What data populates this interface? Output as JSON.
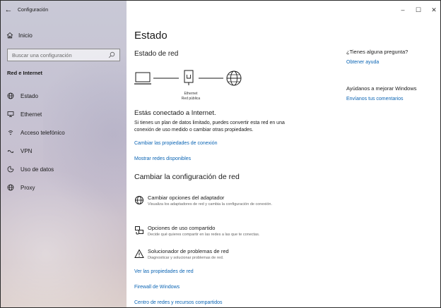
{
  "window": {
    "title": "Configuración",
    "controls": {
      "minimize": "–",
      "maximize": "☐",
      "close": "✕"
    }
  },
  "sidebar": {
    "home_label": "Inicio",
    "search_placeholder": "Buscar una configuración",
    "section_label": "Red e Internet",
    "items": [
      {
        "label": "Estado",
        "icon": "globe-icon"
      },
      {
        "label": "Ethernet",
        "icon": "monitor-icon"
      },
      {
        "label": "Acceso telefónico",
        "icon": "dialup-icon"
      },
      {
        "label": "VPN",
        "icon": "vpn-icon"
      },
      {
        "label": "Uso de datos",
        "icon": "data-usage-icon"
      },
      {
        "label": "Proxy",
        "icon": "globe-icon"
      }
    ]
  },
  "main": {
    "title": "Estado",
    "subtitle": "Estado de red",
    "diagram": {
      "adapter_label": "Ethernet",
      "network_label": "Red pública"
    },
    "connected_text": "Estás conectado a Internet.",
    "description": "Si tienes un plan de datos limitado, puedes convertir esta red en una conexión de uso medido o cambiar otras propiedades.",
    "links": {
      "change_properties": "Cambiar las propiedades de conexión",
      "show_networks": "Mostrar redes disponibles"
    },
    "section_title": "Cambiar la configuración de red",
    "options": [
      {
        "title": "Cambiar opciones del adaptador",
        "subtitle": "Visualiza los adaptadores de red y cambia la configuración de conexión."
      },
      {
        "title": "Opciones de uso compartido",
        "subtitle": "Decide qué quieres compartir en las redes a las que te conectas."
      },
      {
        "title": "Solucionador de problemas de red",
        "subtitle": "Diagnosticar y solucionar problemas de red."
      }
    ],
    "bottom_links": {
      "network_properties": "Ver las propiedades de red",
      "firewall": "Firewall de Windows",
      "network_center": "Centro de redes y recursos compartidos"
    }
  },
  "right_panel": {
    "question": "¿Tienes alguna pregunta?",
    "help_link": "Obtener ayuda",
    "improve": "Ayúdanos a mejorar Windows",
    "feedback_link": "Envíanos tus comentarios"
  },
  "colors": {
    "accent": "#0a64b4",
    "text": "#1a1a1a"
  }
}
